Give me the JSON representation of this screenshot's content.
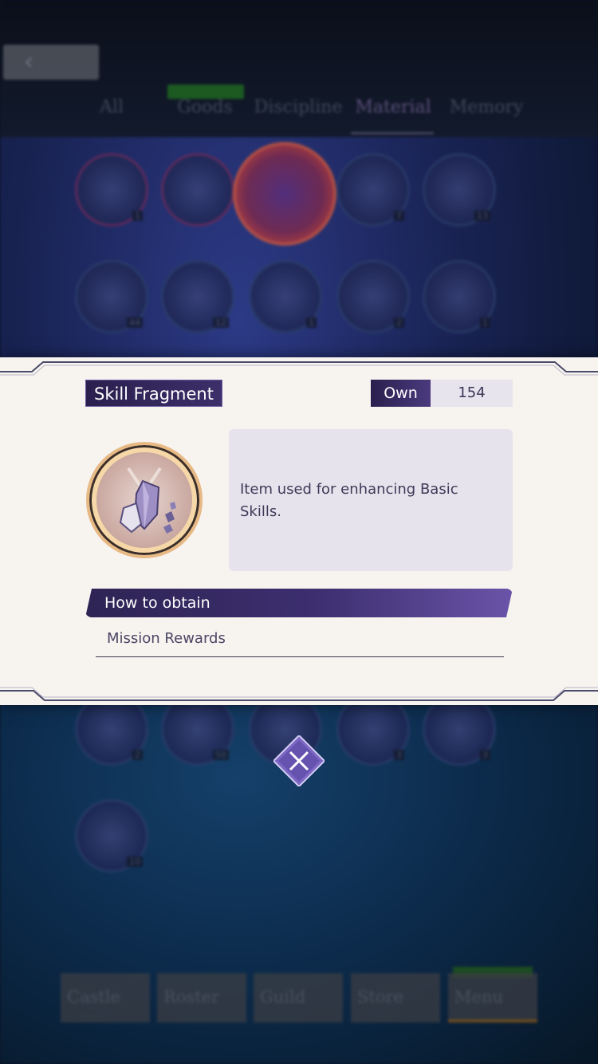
{
  "background": {
    "tabs": [
      {
        "label": "All"
      },
      {
        "label": "Goods"
      },
      {
        "label": "Discipline"
      },
      {
        "label": "Material"
      },
      {
        "label": "Memory"
      }
    ],
    "active_tab": "Material",
    "items_row1": [
      "1",
      "",
      "",
      "7",
      "13"
    ],
    "items_row2": [
      "44",
      "12",
      "1",
      "2",
      "1"
    ],
    "items_row3": [
      "2",
      "50",
      "",
      "3",
      "3"
    ],
    "items_row4": [
      "10"
    ],
    "bottom_nav": [
      "Castle",
      "Roster",
      "Guild",
      "Store",
      "Menu"
    ]
  },
  "popup": {
    "item_name": "Skill Fragment",
    "own_label": "Own",
    "own_value": "154",
    "description": "Item used for enhancing Basic Skills.",
    "obtain_heading": "How to obtain",
    "obtain_sources": [
      "Mission Rewards"
    ]
  },
  "icons": {
    "item": "skill-fragment-icon",
    "close": "close-icon",
    "back": "chevron-left-icon"
  },
  "colors": {
    "accent": "#3c2f6a",
    "panel": "#f7f3ef"
  }
}
